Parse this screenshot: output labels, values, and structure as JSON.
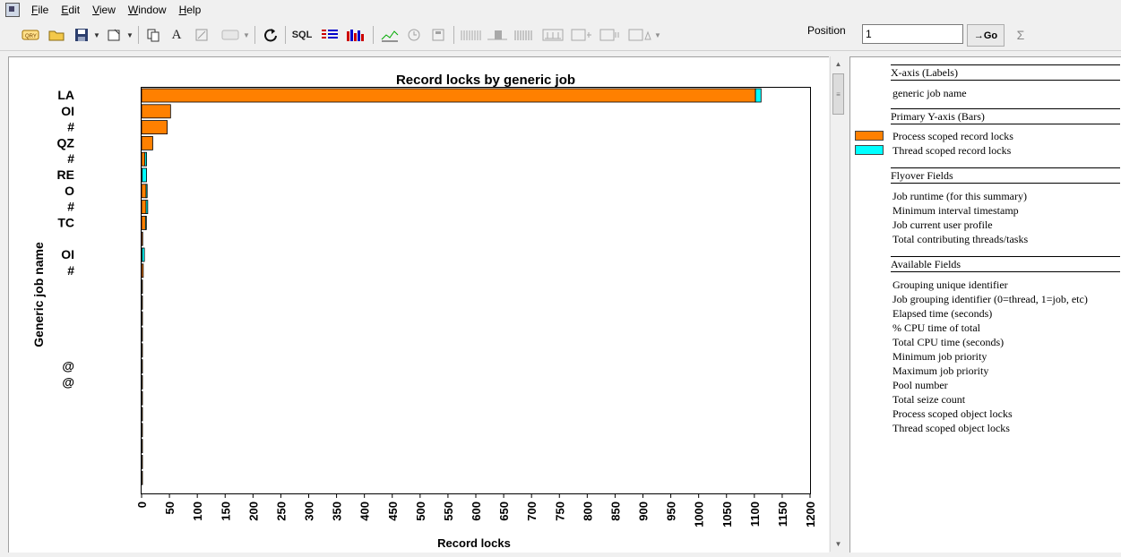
{
  "menu": {
    "items": [
      "File",
      "Edit",
      "View",
      "Window",
      "Help"
    ]
  },
  "toolbar": {
    "sql_label": "SQL",
    "text_tool_label": "A",
    "position_label": "Position",
    "position_value": "1",
    "go_label": "→Go",
    "sum_label": "Σ"
  },
  "chart_data": {
    "type": "bar",
    "orientation": "horizontal",
    "stacked": true,
    "title": "Record locks by generic job",
    "xlabel": "Record locks",
    "ylabel": "Generic job name",
    "xlim": [
      0,
      1200
    ],
    "xticks": [
      "0",
      "50",
      "100",
      "150",
      "200",
      "250",
      "300",
      "350",
      "400",
      "450",
      "500",
      "550",
      "600",
      "650",
      "700",
      "750",
      "800",
      "850",
      "900",
      "950",
      "1000",
      "1050",
      "1100",
      "1150",
      "1200"
    ],
    "categories": [
      "LA",
      "OI",
      "#",
      "QZ",
      "#",
      "RE",
      "O",
      "#",
      "TC",
      "",
      "OI",
      "#",
      "",
      "",
      "",
      "",
      "",
      "@",
      "@",
      "",
      "",
      "",
      "",
      "",
      ""
    ],
    "series": [
      {
        "name": "Process scoped record locks",
        "color": "#ff8000",
        "values": [
          1102,
          52,
          46,
          20,
          6,
          1,
          8,
          8,
          7,
          2,
          1,
          3,
          1,
          1,
          1,
          1,
          1,
          1,
          1,
          1,
          1,
          1,
          1,
          1,
          1
        ]
      },
      {
        "name": "Thread scoped record locks",
        "color": "#00ffff",
        "values": [
          10,
          0,
          0,
          0,
          3,
          8,
          2,
          3,
          1,
          0,
          4,
          0,
          0,
          0,
          0,
          0,
          0,
          0,
          0,
          0,
          0,
          0,
          0,
          0,
          0
        ]
      }
    ],
    "grid": false,
    "legend": "right"
  },
  "legend_panel": {
    "x_axis_header": "X-axis (Labels)",
    "x_axis_field": "generic job name",
    "y_axis_header": "Primary Y-axis (Bars)",
    "bar_fields": [
      "Process scoped record locks",
      "Thread scoped record locks"
    ],
    "flyover_header": "Flyover Fields",
    "flyover_fields": [
      "Job runtime (for this summary)",
      "Minimum interval timestamp",
      "Job current user profile",
      "Total contributing threads/tasks"
    ],
    "available_header": "Available Fields",
    "available_fields": [
      "Grouping unique identifier",
      "Job grouping identifier (0=thread, 1=job, etc)",
      "Elapsed time (seconds)",
      "% CPU time of total",
      "Total CPU time (seconds)",
      "Minimum job priority",
      "Maximum job priority",
      "Pool number",
      "Total seize count",
      "Process scoped object locks",
      "Thread scoped object locks"
    ]
  }
}
